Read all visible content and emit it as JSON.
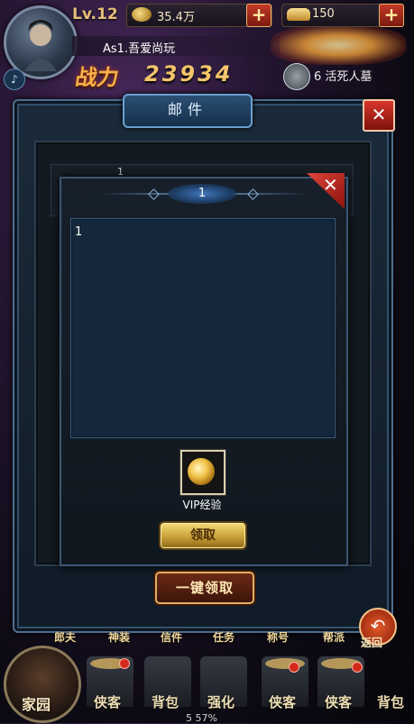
{
  "hud": {
    "level": "Lv.12",
    "silver": "35.4万",
    "gold": "150",
    "player_name": "As1.吾爱尚玩",
    "power_label": "战力",
    "power_value": "23934",
    "event_text": "6 活死人墓",
    "sound_icon": "speaker-icon"
  },
  "mail": {
    "title": "邮件",
    "close_icon": "close-icon",
    "list_peek_text": "1"
  },
  "detail": {
    "title": "1",
    "body": "1",
    "attachment_label": "VIP经验",
    "attachment_icon": "vip-exp-orb-icon",
    "claim_label": "领取",
    "claim_all_label": "一键领取"
  },
  "bottom": {
    "menu": [
      "郎夫",
      "神装",
      "信件",
      "任务",
      "称号",
      "帮派"
    ],
    "home_label": "家园",
    "back_label": "返回",
    "slots": [
      "侠客",
      "背包",
      "强化",
      "侠客",
      "侠客",
      "背包"
    ],
    "footer": "5   57%"
  },
  "colors": {
    "accent_gold": "#caa23a",
    "close_red": "#d8352a",
    "frame_blue": "#4e6d8d"
  }
}
